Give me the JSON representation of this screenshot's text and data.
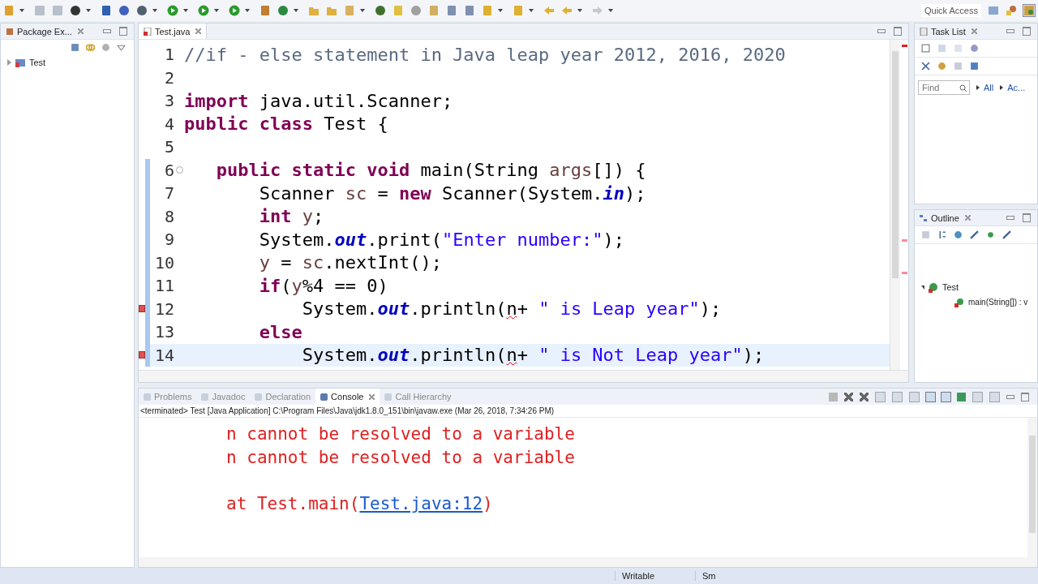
{
  "toolbar": {
    "quick_access": "Quick Access"
  },
  "package_explorer": {
    "tab": {
      "label": "Package Ex...",
      "selected": false
    },
    "tree": [
      {
        "label": "Test",
        "expanded": false
      }
    ]
  },
  "editor": {
    "tab": {
      "label": "Test.java",
      "selected": true
    },
    "lines": [
      {
        "number": "1",
        "current": false,
        "changed": false,
        "error": false,
        "foldable": false,
        "tokens": [
          {
            "kind": "comment",
            "text": "//if - else statement in Java leap year 2012, 2016, 2020"
          }
        ]
      },
      {
        "number": "2",
        "current": false,
        "changed": false,
        "error": false,
        "foldable": false
      },
      {
        "number": "3",
        "current": false,
        "changed": false,
        "error": false,
        "foldable": false,
        "tokens": [
          {
            "kind": "keyword",
            "text": "import"
          },
          {
            "kind": "plain",
            "text": " java.util.Scanner;"
          }
        ]
      },
      {
        "number": "4",
        "current": false,
        "changed": false,
        "error": false,
        "foldable": false,
        "tokens": [
          {
            "kind": "keyword",
            "text": "public class"
          },
          {
            "kind": "plain",
            "text": " Test {"
          }
        ]
      },
      {
        "number": "5",
        "current": false,
        "changed": false,
        "error": false,
        "foldable": false
      },
      {
        "number": "6",
        "current": false,
        "changed": true,
        "error": false,
        "foldable": true,
        "tokens": [
          {
            "kind": "keyword",
            "text": "   public static void"
          },
          {
            "kind": "plain",
            "text": " main(String "
          },
          {
            "kind": "param",
            "text": "args"
          },
          {
            "kind": "plain",
            "text": "[]) {"
          }
        ]
      },
      {
        "number": "7",
        "current": false,
        "changed": true,
        "error": false,
        "foldable": false,
        "tokens": [
          {
            "kind": "plain",
            "text": "       Scanner "
          },
          {
            "kind": "local",
            "text": "sc"
          },
          {
            "kind": "plain",
            "text": " = "
          },
          {
            "kind": "keyword",
            "text": "new"
          },
          {
            "kind": "plain",
            "text": " Scanner(System."
          },
          {
            "kind": "field",
            "text": "in"
          },
          {
            "kind": "plain",
            "text": ");"
          }
        ]
      },
      {
        "number": "8",
        "current": false,
        "changed": true,
        "error": false,
        "foldable": false,
        "tokens": [
          {
            "kind": "keyword",
            "text": "       int"
          },
          {
            "kind": "local",
            "text": " y"
          },
          {
            "kind": "plain",
            "text": ";"
          }
        ]
      },
      {
        "number": "9",
        "current": false,
        "changed": true,
        "error": false,
        "foldable": false,
        "tokens": [
          {
            "kind": "plain",
            "text": "       System."
          },
          {
            "kind": "field",
            "text": "out"
          },
          {
            "kind": "plain",
            "text": ".print("
          },
          {
            "kind": "string",
            "text": "\"Enter number:\""
          },
          {
            "kind": "plain",
            "text": ");"
          }
        ]
      },
      {
        "number": "10",
        "current": false,
        "changed": true,
        "error": false,
        "foldable": false,
        "tokens": [
          {
            "kind": "local",
            "text": "       y"
          },
          {
            "kind": "plain",
            "text": " = "
          },
          {
            "kind": "local",
            "text": "sc"
          },
          {
            "kind": "plain",
            "text": ".nextInt();"
          }
        ]
      },
      {
        "number": "11",
        "current": false,
        "changed": true,
        "error": false,
        "foldable": false,
        "tokens": [
          {
            "kind": "keyword",
            "text": "       if"
          },
          {
            "kind": "plain",
            "text": "("
          },
          {
            "kind": "local",
            "text": "y"
          },
          {
            "kind": "plain",
            "text": "%4 == 0)"
          }
        ]
      },
      {
        "number": "12",
        "current": false,
        "changed": true,
        "error": true,
        "foldable": false,
        "tokens": [
          {
            "kind": "plain",
            "text": "           System."
          },
          {
            "kind": "field",
            "text": "out"
          },
          {
            "kind": "plain",
            "text": ".println("
          },
          {
            "kind": "error",
            "text": "n"
          },
          {
            "kind": "plain",
            "text": "+ "
          },
          {
            "kind": "string",
            "text": "\" is Leap year\""
          },
          {
            "kind": "plain",
            "text": ");"
          }
        ]
      },
      {
        "number": "13",
        "current": false,
        "changed": true,
        "error": false,
        "foldable": false,
        "tokens": [
          {
            "kind": "keyword",
            "text": "       else"
          }
        ]
      },
      {
        "number": "14",
        "current": true,
        "changed": true,
        "error": true,
        "foldable": false,
        "tokens": [
          {
            "kind": "plain",
            "text": "           System."
          },
          {
            "kind": "field",
            "text": "out"
          },
          {
            "kind": "plain",
            "text": ".println("
          },
          {
            "kind": "error",
            "text": "n"
          },
          {
            "kind": "plain",
            "text": "+ "
          },
          {
            "kind": "string",
            "text": "\" is Not Leap year\""
          },
          {
            "kind": "plain",
            "text": ");"
          }
        ]
      }
    ]
  },
  "task_list": {
    "tab": {
      "label": "Task List",
      "selected": false
    },
    "find": {
      "placeholder": "Find"
    },
    "filters": [
      "All",
      "Ac..."
    ]
  },
  "outline": {
    "tab": {
      "label": "Outline",
      "selected": false
    },
    "tree": [
      {
        "label": "Test",
        "expanded": true,
        "children": [
          {
            "label": "main(String[]) : v"
          }
        ]
      }
    ]
  },
  "bottom_tabs": [
    {
      "label": "Problems",
      "selected": false
    },
    {
      "label": "Javadoc",
      "selected": false
    },
    {
      "label": "Declaration",
      "selected": false
    },
    {
      "label": "Console",
      "selected": true
    },
    {
      "label": "Call Hierarchy",
      "selected": false
    }
  ],
  "console": {
    "header": "<terminated> Test [Java Application] C:\\Program Files\\Java\\jdk1.8.0_151\\bin\\javaw.exe (Mar 26, 2018, 7:34:26 PM)",
    "lines": [
      {
        "kind": "error",
        "text": "n cannot be resolved to a variable"
      },
      {
        "kind": "error",
        "text": "n cannot be resolved to a variable"
      },
      {
        "kind": "blank"
      },
      {
        "kind": "trace",
        "before": "at Test.main(",
        "link": "Test.java:12",
        "after": ")"
      }
    ]
  },
  "status_bar": [
    "Writable",
    "Sm"
  ]
}
